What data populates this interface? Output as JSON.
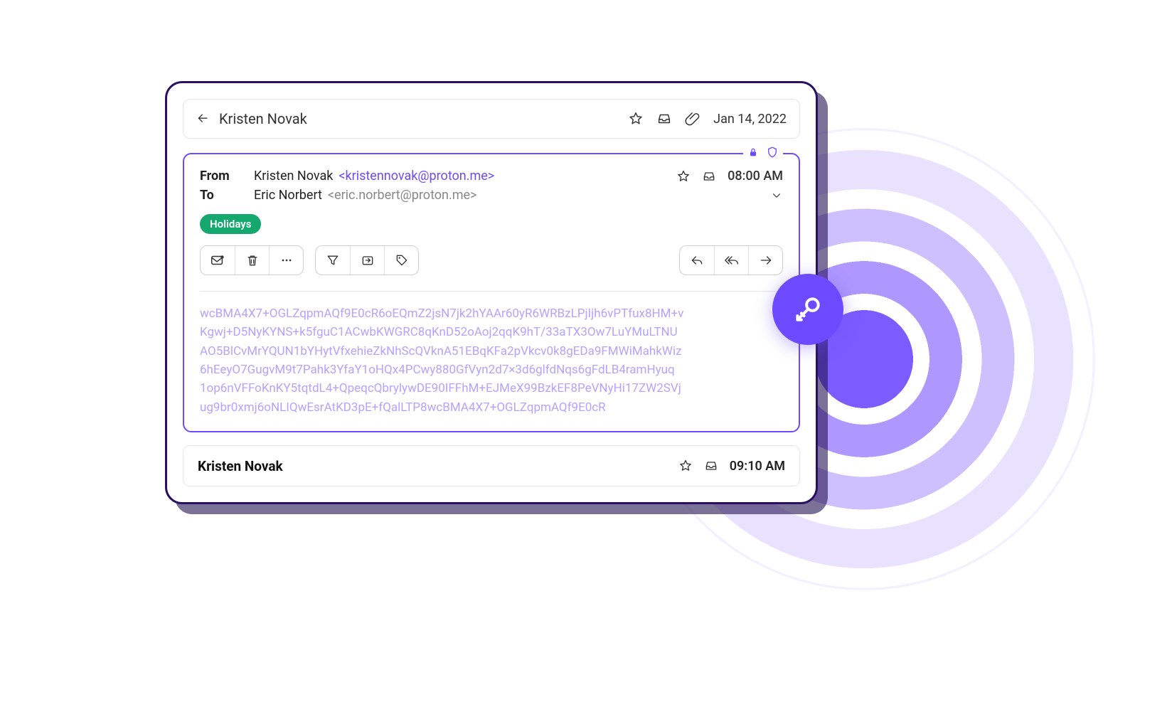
{
  "colors": {
    "accent": "#6d4aff",
    "tag_bg": "#14a86e"
  },
  "thread": {
    "sender": "Kristen Novak",
    "date": "Jan 14, 2022"
  },
  "message": {
    "from_label": "From",
    "from_name": "Kristen Novak",
    "from_email": "<kristennovak@proton.me>",
    "to_label": "To",
    "to_name": "Eric Norbert",
    "to_email": "<eric.norbert@proton.me>",
    "time": "08:00 AM",
    "tag": "Holidays",
    "ciphertext": "wcBMA4X7+OGLZqpmAQf9E0cR6oEQmZ2jsN7jk2hYAAr60yR6WRBzLPjIjh6vPTfux8HM+v\nKgwj+D5NyKYNS+k5fguC1ACwbKWGRC8qKnD52oAoj2qqK9hT/33aTX3Ow7LuYMuLTNU\nAO5BlCvMrYQUN1bYHytVfxehieZkNhScQVknA51EBqKFa2pVkcv0k8gEDa9FMWiMahkWiz\n6hEeyO7GugvM9t7Pahk3YfaY1oHQx4PCwy880GfVyn2d7×3d6glfdNqs6gFdLB4ramHyuq\n1op6nVFFoKnKY5tqtdL4+QpeqcQbrylywDE90IFFhM+EJMeX99BzkEF8PeVNyHi17ZW2SVj\nug9br0xmj6oNLIQwEsrAtKD3pE+fQalLTP8wcBMA4X7+OGLZqpmAQf9E0cR"
  },
  "list_item": {
    "sender": "Kristen Novak",
    "time": "09:10 AM"
  },
  "icons": {
    "reply": "reply-icon",
    "star": "star-icon",
    "inbox": "inbox-icon",
    "paperclip": "paperclip-icon",
    "lock": "lock-icon",
    "shield": "shield-icon",
    "chevron_down": "chevron-down-icon",
    "mark_read": "mark-read-icon",
    "trash": "trash-icon",
    "more": "more-icon",
    "filter": "filter-icon",
    "move": "move-to-icon",
    "label": "label-icon",
    "reply_single": "reply-icon",
    "reply_all": "reply-all-icon",
    "forward": "forward-icon",
    "key": "key-icon"
  }
}
